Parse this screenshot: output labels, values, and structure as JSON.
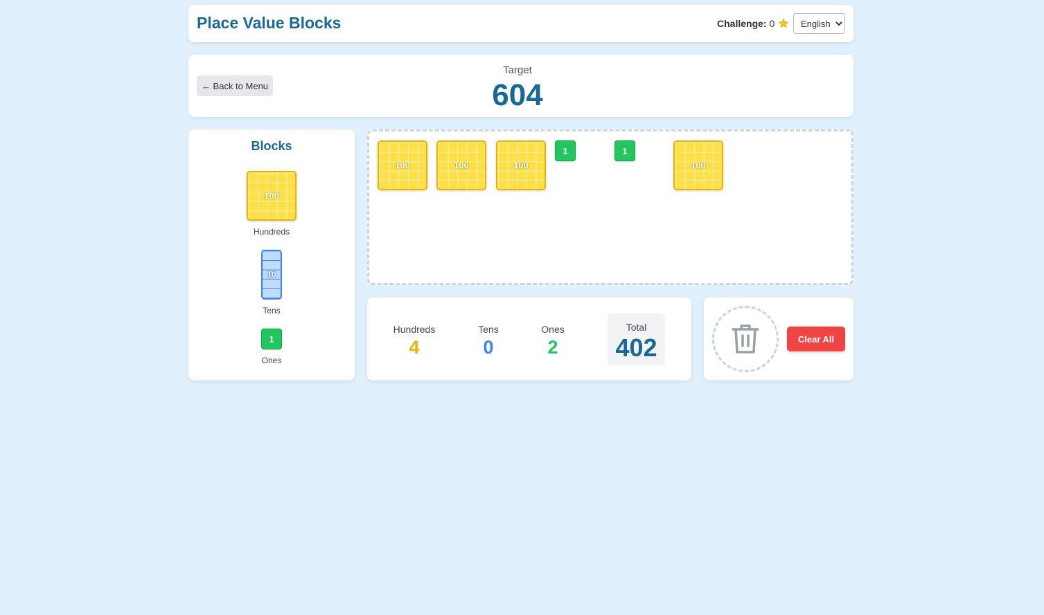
{
  "header": {
    "title": "Place Value Blocks",
    "challenge_label": "Challenge:",
    "challenge_value": "0",
    "language_selected": "English"
  },
  "target": {
    "back_label": "← Back to Menu",
    "label": "Target",
    "value": "604"
  },
  "palette": {
    "title": "Blocks",
    "hundreds_block_text": "100",
    "hundreds_label": "Hundreds",
    "tens_block_text": "10",
    "tens_label": "Tens",
    "ones_block_text": "1",
    "ones_label": "Ones"
  },
  "workspace": {
    "blocks": [
      "100",
      "100",
      "100",
      "1",
      "1",
      "100"
    ]
  },
  "counts": {
    "hundreds_label": "Hundreds",
    "hundreds_value": "4",
    "tens_label": "Tens",
    "tens_value": "0",
    "ones_label": "Ones",
    "ones_value": "2",
    "total_label": "Total",
    "total_value": "402"
  },
  "actions": {
    "clear_label": "Clear All"
  },
  "icons": {
    "star": "star-icon",
    "trash": "trash-icon"
  },
  "colors": {
    "primary": "#1a6896",
    "hundreds": "#eab308",
    "tens": "#3b82f6",
    "ones": "#22c55e",
    "danger": "#ef4444",
    "background": "#e0f0fc"
  }
}
